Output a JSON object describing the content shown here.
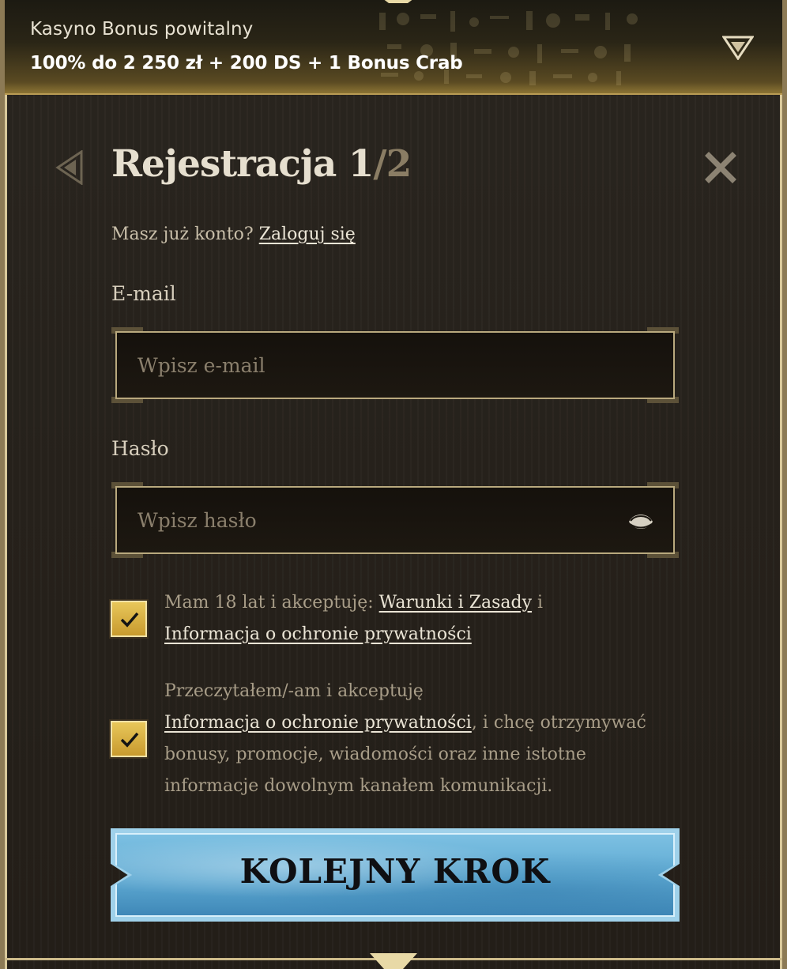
{
  "banner": {
    "title": "Kasyno Bonus powitalny",
    "offer": "100% do 2 250 zł + 200 DS + 1 Bonus Crab",
    "toggle_icon": "triangle-down-icon"
  },
  "header": {
    "title_main": "Rejestracja 1",
    "title_sep": "/",
    "title_total": "2",
    "back_icon": "triangle-left-icon",
    "close_icon": "close-icon"
  },
  "login_prompt": {
    "text": "Masz już konto? ",
    "link": "Zaloguj się"
  },
  "email": {
    "label": "E-mail",
    "value": "",
    "placeholder": "Wpisz e-mail"
  },
  "password": {
    "label": "Hasło",
    "value": "",
    "placeholder": "Wpisz hasło",
    "toggle_icon": "eye-icon"
  },
  "consent_terms": {
    "checked": true,
    "text_before": "Mam 18 lat i akceptuję: ",
    "link_terms": "Warunki i Zasady",
    "text_mid": " i",
    "link_privacy": "Informacja o ochronie prywatności"
  },
  "consent_marketing": {
    "checked": true,
    "text_before": "Przeczytałem/-am i akceptuję",
    "link_privacy": "Informacja o ochronie prywatności",
    "text_after": ", i chcę otrzymywać bonusy, promocje, wiadomości oraz inne istotne informacje dowolnym kanałem komunikacji."
  },
  "next_button": {
    "label": "KOLEJNY KROK"
  },
  "colors": {
    "gold": "#c89a2e",
    "button_blue": "#5ea9d2",
    "frame": "#8c7a55"
  }
}
